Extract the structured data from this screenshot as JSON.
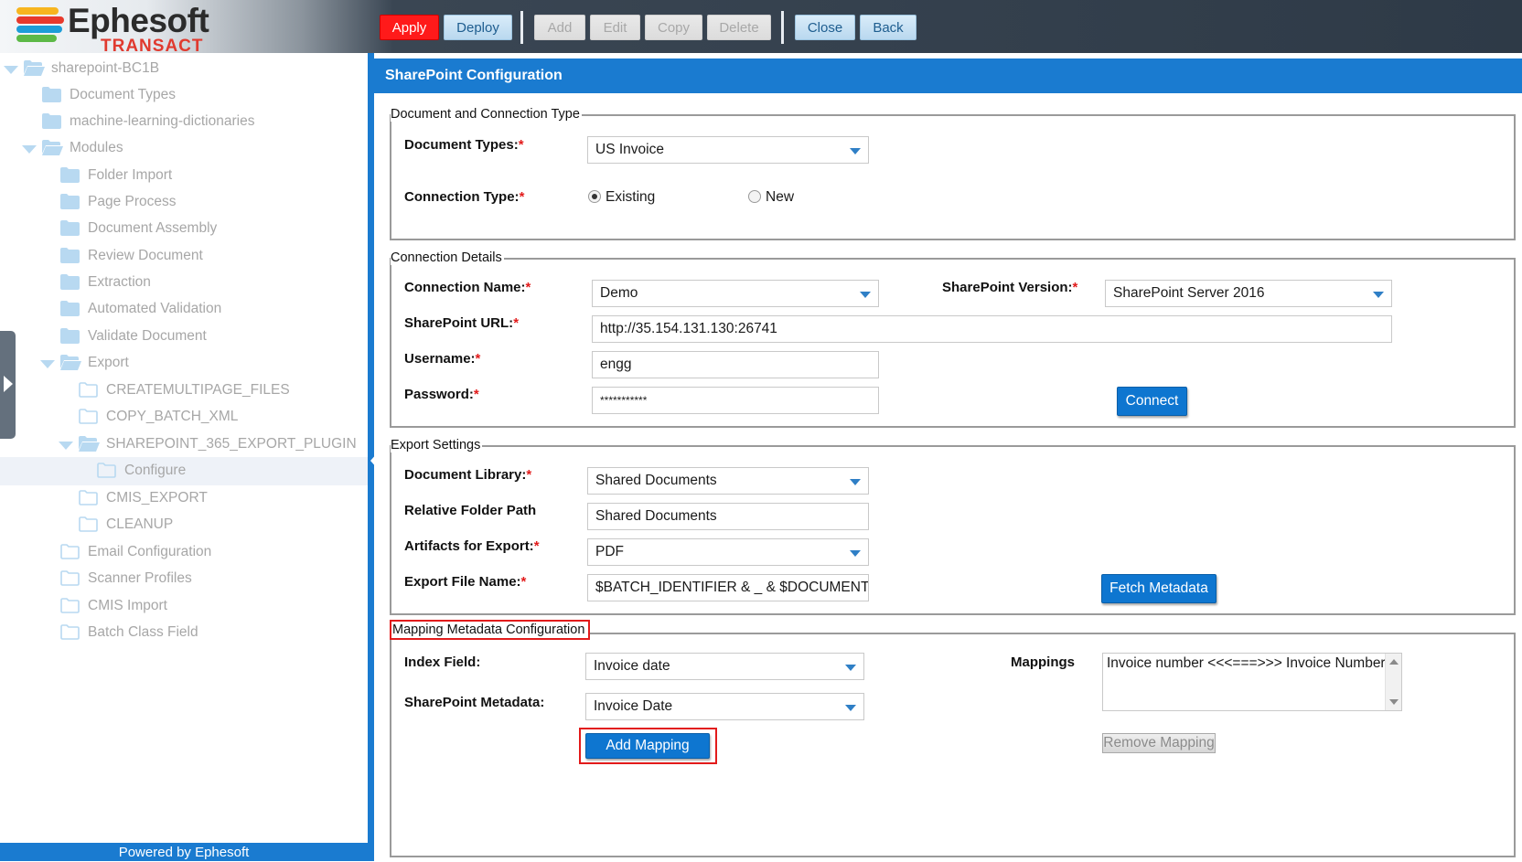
{
  "header": {
    "logo_word": "Ephesoft",
    "logo_sub": "TRANSACT",
    "toolbar": {
      "apply": "Apply",
      "deploy": "Deploy",
      "add": "Add",
      "edit": "Edit",
      "copy": "Copy",
      "delete": "Delete",
      "close": "Close",
      "back": "Back"
    }
  },
  "tree": {
    "items": [
      {
        "label": "sharepoint-BC1B",
        "expanded": true,
        "icon": "folder-open-icon"
      },
      {
        "label": "Document Types",
        "expanded": false,
        "icon": "folder-icon"
      },
      {
        "label": "machine-learning-dictionaries",
        "expanded": false,
        "icon": "folder-icon"
      },
      {
        "label": "Modules",
        "expanded": true,
        "icon": "folder-open-icon"
      },
      {
        "label": "Folder Import",
        "expanded": false,
        "icon": "folder-icon"
      },
      {
        "label": "Page Process",
        "expanded": false,
        "icon": "folder-icon"
      },
      {
        "label": "Document Assembly",
        "expanded": false,
        "icon": "folder-icon"
      },
      {
        "label": "Review Document",
        "expanded": false,
        "icon": "folder-icon"
      },
      {
        "label": "Extraction",
        "expanded": false,
        "icon": "folder-icon"
      },
      {
        "label": "Automated Validation",
        "expanded": false,
        "icon": "folder-icon"
      },
      {
        "label": "Validate Document",
        "expanded": false,
        "icon": "folder-icon"
      },
      {
        "label": "Export",
        "expanded": true,
        "icon": "folder-open-icon"
      },
      {
        "label": "CREATEMULTIPAGE_FILES",
        "icon": "folder-outline-icon"
      },
      {
        "label": "COPY_BATCH_XML",
        "icon": "folder-outline-icon"
      },
      {
        "label": "SHAREPOINT_365_EXPORT_PLUGIN",
        "expanded": true,
        "icon": "folder-open-icon"
      },
      {
        "label": "Configure",
        "icon": "folder-outline-icon",
        "selected": true
      },
      {
        "label": "CMIS_EXPORT",
        "icon": "folder-outline-icon"
      },
      {
        "label": "CLEANUP",
        "icon": "folder-outline-icon"
      },
      {
        "label": "Email Configuration",
        "icon": "folder-outline-icon"
      },
      {
        "label": "Scanner Profiles",
        "icon": "folder-outline-icon"
      },
      {
        "label": "CMIS Import",
        "icon": "folder-outline-icon"
      },
      {
        "label": "Batch Class Field",
        "icon": "folder-outline-icon"
      }
    ],
    "footer": "Powered by Ephesoft"
  },
  "panel": {
    "title": "SharePoint Configuration",
    "doc_conn": {
      "legend": "Document and Connection Type",
      "document_types_label": "Document Types:",
      "document_types_value": "US Invoice",
      "connection_type_label": "Connection Type:",
      "radio_existing": "Existing",
      "radio_new": "New",
      "selected": "Existing"
    },
    "conn_details": {
      "legend": "Connection Details",
      "connection_name_label": "Connection Name:",
      "connection_name_value": "Demo",
      "sp_version_label": "SharePoint Version:",
      "sp_version_value": "SharePoint Server 2016",
      "sp_url_label": "SharePoint URL:",
      "sp_url_value": "http://35.154.131.130:26741",
      "username_label": "Username:",
      "username_value": "engg",
      "password_label": "Password:",
      "password_value": "***********",
      "connect_button": "Connect"
    },
    "export_settings": {
      "legend": "Export Settings",
      "doc_library_label": "Document Library:",
      "doc_library_value": "Shared Documents",
      "relative_path_label": "Relative Folder Path",
      "relative_path_value": "Shared Documents",
      "artifacts_label": "Artifacts for Export:",
      "artifacts_value": "PDF",
      "export_file_label": "Export File Name:",
      "export_file_value": "$BATCH_IDENTIFIER & _ & $DOCUMENT",
      "fetch_button": "Fetch Metadata"
    },
    "mapping": {
      "legend": "Mapping Metadata Configuration",
      "index_field_label": "Index Field:",
      "index_field_value": "Invoice date",
      "sp_metadata_label": "SharePoint Metadata:",
      "sp_metadata_value": "Invoice Date",
      "add_mapping_button": "Add Mapping",
      "mappings_label": "Mappings",
      "mappings_items": [
        "Invoice number <<<===>>> Invoice Number"
      ],
      "remove_mapping_button": "Remove Mapping"
    }
  },
  "colors": {
    "accent_blue": "#1a7bd0",
    "apply_red": "#ff1a1a",
    "required_red": "#e21b1b",
    "tree_text": "#a7a7a7",
    "tree_icon": "#b8d9f1"
  }
}
